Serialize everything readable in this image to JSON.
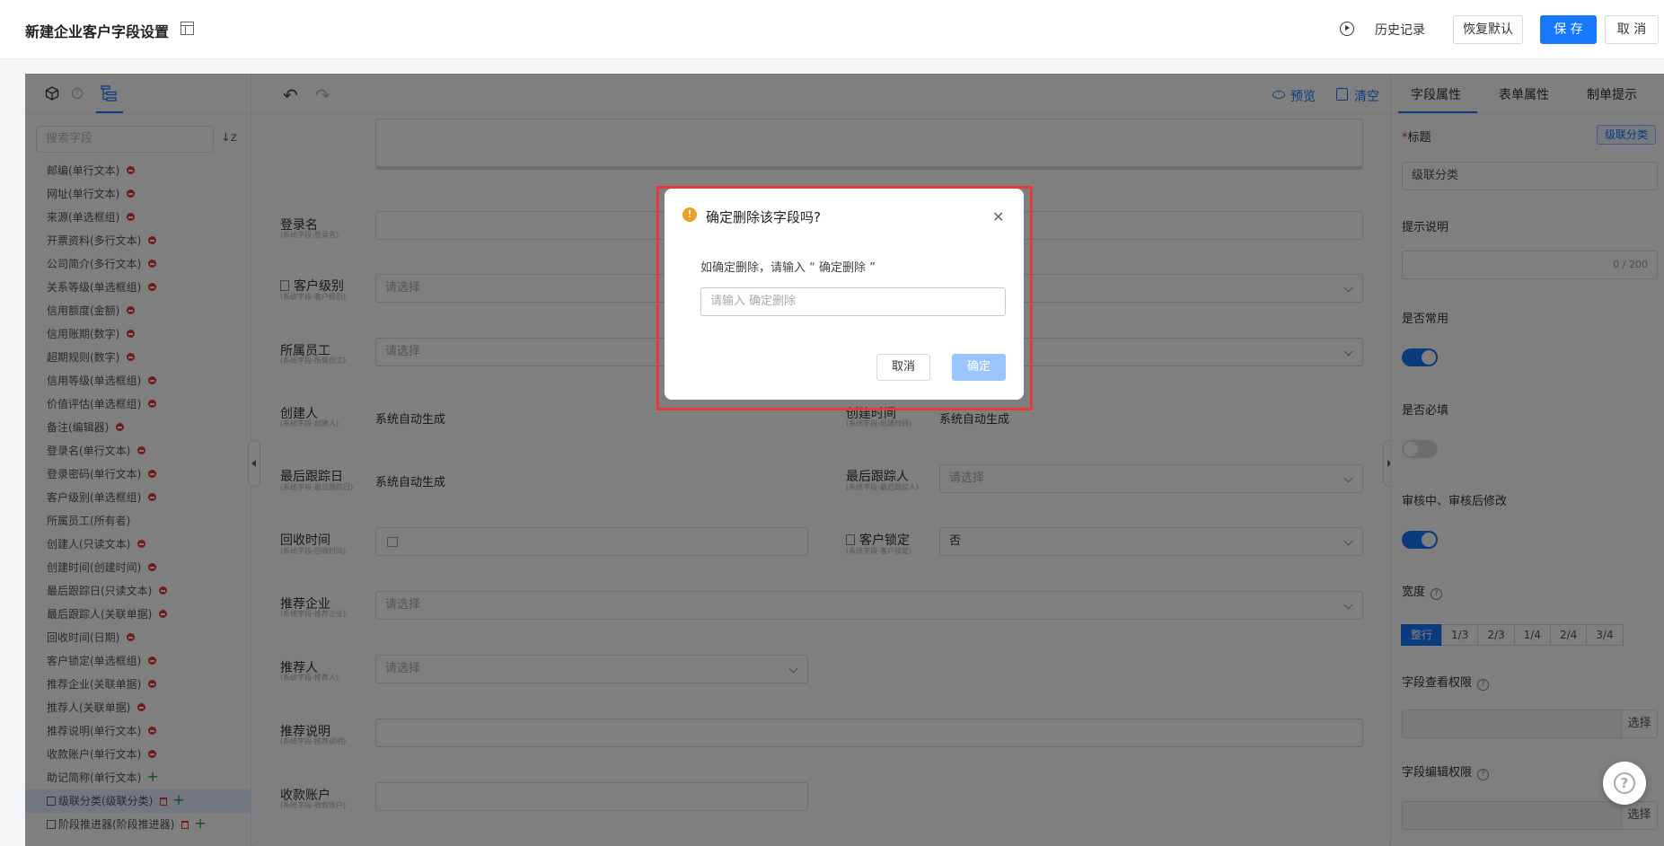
{
  "header": {
    "title": "新建企业客户字段设置",
    "history_label": "历史记录",
    "restore_label": "恢复默认",
    "save_label": "保 存",
    "cancel_label": "取 消"
  },
  "left_panel": {
    "search_placeholder": "搜索字段",
    "fields": [
      {
        "label": "邮编(单行文本)",
        "action": "minus"
      },
      {
        "label": "网址(单行文本)",
        "action": "minus"
      },
      {
        "label": "来源(单选框组)",
        "action": "minus"
      },
      {
        "label": "开票资料(多行文本)",
        "action": "minus"
      },
      {
        "label": "公司简介(多行文本)",
        "action": "minus"
      },
      {
        "label": "关系等级(单选框组)",
        "action": "minus"
      },
      {
        "label": "信用额度(金额)",
        "action": "minus"
      },
      {
        "label": "信用账期(数字)",
        "action": "minus"
      },
      {
        "label": "超期规则(数字)",
        "action": "minus"
      },
      {
        "label": "信用等级(单选框组)",
        "action": "minus"
      },
      {
        "label": "价值评估(单选框组)",
        "action": "minus"
      },
      {
        "label": "备注(编辑器)",
        "action": "minus"
      },
      {
        "label": "登录名(单行文本)",
        "action": "minus"
      },
      {
        "label": "登录密码(单行文本)",
        "action": "minus"
      },
      {
        "label": "客户级别(单选框组)",
        "action": "minus"
      },
      {
        "label": "所属员工(所有者)",
        "action": "none"
      },
      {
        "label": "创建人(只读文本)",
        "action": "minus"
      },
      {
        "label": "创建时间(创建时间)",
        "action": "minus"
      },
      {
        "label": "最后跟踪日(只读文本)",
        "action": "minus"
      },
      {
        "label": "最后跟踪人(关联单据)",
        "action": "minus"
      },
      {
        "label": "回收时间(日期)",
        "action": "minus"
      },
      {
        "label": "客户锁定(单选框组)",
        "action": "minus"
      },
      {
        "label": "推荐企业(关联单据)",
        "action": "minus"
      },
      {
        "label": "推荐人(关联单据)",
        "action": "minus"
      },
      {
        "label": "推荐说明(单行文本)",
        "action": "minus"
      },
      {
        "label": "收款账户(单行文本)",
        "action": "minus"
      },
      {
        "label": "助记简称(单行文本)",
        "action": "plus"
      },
      {
        "label": "级联分类(级联分类)",
        "action": "trash-plus"
      },
      {
        "label": "阶段推进器(阶段推进器)",
        "action": "trash-plus"
      }
    ]
  },
  "toolbar": {
    "preview_label": "预览",
    "clear_label": "清空"
  },
  "form": {
    "login_name": {
      "label": "登录名",
      "sub": "(系统字段-登录名)"
    },
    "customer_level": {
      "label": "客户级别",
      "sub": "(系统字段-客户级别)",
      "placeholder": "请选择"
    },
    "owner": {
      "label": "所属员工",
      "sub": "(系统字段-所属员工)",
      "placeholder": "请选择"
    },
    "creator": {
      "label": "创建人",
      "sub": "(系统字段-创建人)",
      "value": "系统自动生成"
    },
    "created_at": {
      "label": "创建时间",
      "sub": "(系统字段-创建时间)",
      "value": "系统自动生成"
    },
    "last_track_date": {
      "label": "最后跟踪日",
      "sub": "(系统字段-最后跟踪日)",
      "value": "系统自动生成"
    },
    "last_tracker": {
      "label": "最后跟踪人",
      "sub": "(系统字段-最后跟踪人)",
      "placeholder": "请选择"
    },
    "recycle_time": {
      "label": "回收时间",
      "sub": "(系统字段-回收时间)"
    },
    "customer_lock": {
      "label": "客户锁定",
      "sub": "(系统字段-客户锁定)",
      "value": "否"
    },
    "ref_company": {
      "label": "推荐企业",
      "sub": "(系统字段-推荐企业)",
      "placeholder": "请选择"
    },
    "referrer": {
      "label": "推荐人",
      "sub": "(系统字段-推荐人)",
      "placeholder": "请选择"
    },
    "ref_note": {
      "label": "推荐说明",
      "sub": "(系统字段-推荐说明)"
    },
    "account": {
      "label": "收款账户",
      "sub": "(系统字段-收款账户)"
    }
  },
  "right_panel": {
    "tabs": [
      "字段属性",
      "表单属性",
      "制单提示"
    ],
    "title_label": "标题",
    "title_tag": "级联分类",
    "title_value": "级联分类",
    "hint_label": "提示说明",
    "hint_count": "0 / 200",
    "common_label": "是否常用",
    "common_on": true,
    "required_label": "是否必填",
    "required_on": false,
    "review_label": "审核中、审核后修改",
    "review_on": true,
    "width_label": "宽度",
    "width_options": [
      "整行",
      "1/3",
      "2/3",
      "1/4",
      "2/4",
      "3/4"
    ],
    "width_selected": "整行",
    "view_perm_label": "字段查看权限",
    "edit_perm_label": "字段编辑权限",
    "select_label": "选择"
  },
  "dialog": {
    "title": "确定删除该字段吗?",
    "message": "如确定删除，请输入 “ 确定删除 ”",
    "input_placeholder": "请输入 确定删除",
    "cancel_label": "取消",
    "ok_label": "确定"
  },
  "colors": {
    "primary": "#1677ff",
    "danger": "#e53935",
    "warning": "#f0a020",
    "highlight_border": "#e53935"
  }
}
